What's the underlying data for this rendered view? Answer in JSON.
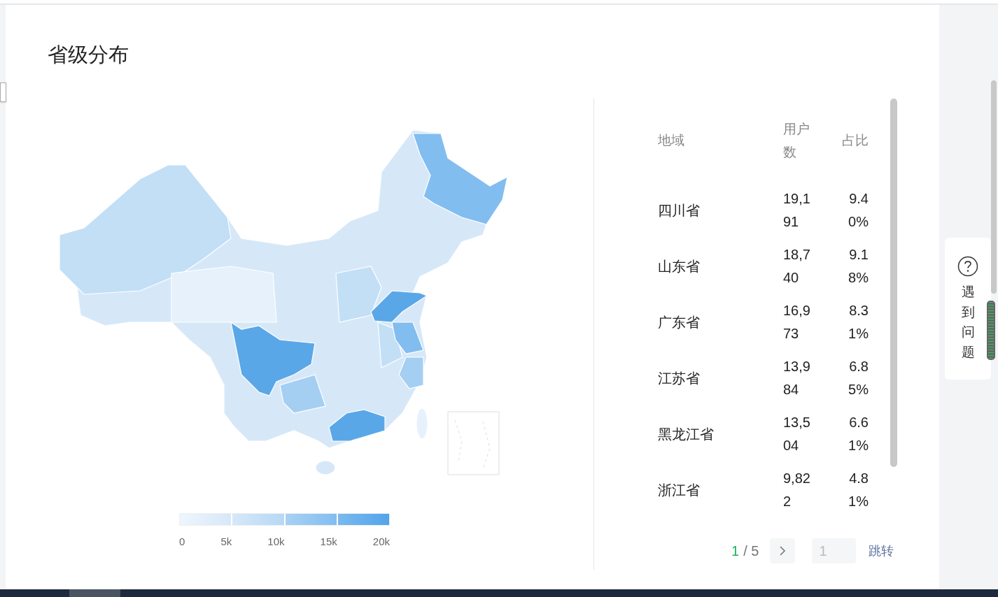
{
  "title": "省级分布",
  "legend": {
    "ticks": [
      "0",
      "5k",
      "10k",
      "15k",
      "20k"
    ]
  },
  "table": {
    "columns": [
      "地域",
      "用户数",
      "占比"
    ],
    "rows": [
      {
        "region": "四川省",
        "users": "19,191",
        "share": "9.40%"
      },
      {
        "region": "山东省",
        "users": "18,740",
        "share": "9.18%"
      },
      {
        "region": "广东省",
        "users": "16,973",
        "share": "8.31%"
      },
      {
        "region": "江苏省",
        "users": "13,984",
        "share": "6.85%"
      },
      {
        "region": "黑龙江省",
        "users": "13,504",
        "share": "6.61%"
      },
      {
        "region": "浙江省",
        "users": "9,822",
        "share": "4.81%"
      }
    ]
  },
  "pagination": {
    "current": "1",
    "separator": "/",
    "total": "5",
    "jump_value": "1",
    "jump_button": "跳转"
  },
  "help": {
    "label": "遇到问题"
  }
}
